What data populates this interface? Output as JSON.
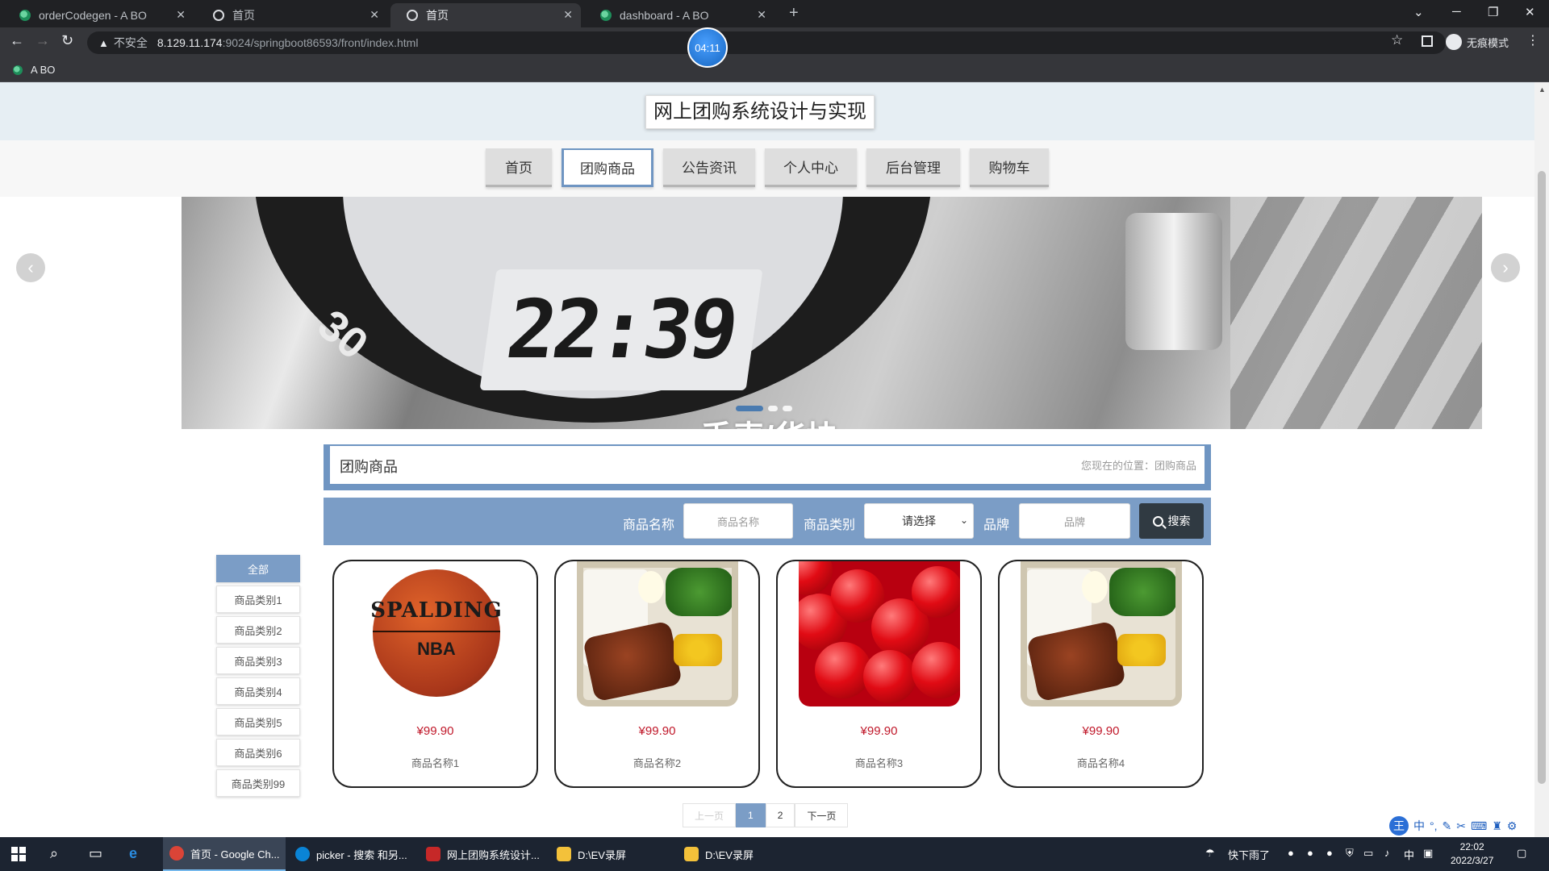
{
  "browser": {
    "tabs": [
      {
        "title": "orderCodegen - A BO",
        "active": false
      },
      {
        "title": "首页",
        "active": false
      },
      {
        "title": "首页",
        "active": true
      },
      {
        "title": "dashboard - A BO",
        "active": false
      }
    ],
    "security_label": "不安全",
    "url_host": "8.129.11.174",
    "url_path": ":9024/springboot86593/front/index.html",
    "profile_label": "无痕模式",
    "bookmark": "A BO",
    "timer": "04:11"
  },
  "site": {
    "title": "网上团购系统设计与实现",
    "nav": [
      {
        "label": "首页",
        "active": false
      },
      {
        "label": "团购商品",
        "active": true
      },
      {
        "label": "公告资讯",
        "active": false
      },
      {
        "label": "个人中心",
        "active": false
      },
      {
        "label": "后台管理",
        "active": false
      },
      {
        "label": "购物车",
        "active": false
      }
    ],
    "banner": {
      "lcd_text": "22:39",
      "bezel_number": "30",
      "caption": "手表/华块"
    }
  },
  "section": {
    "title": "团购商品",
    "breadcrumb": "您现在的位置：团购商品"
  },
  "search": {
    "name_label": "商品名称",
    "name_placeholder": "商品名称",
    "category_label": "商品类别",
    "category_selected": "请选择",
    "brand_label": "品牌",
    "brand_placeholder": "品牌",
    "button_label": "搜索"
  },
  "categories": [
    "全部",
    "商品类别1",
    "商品类别2",
    "商品类别3",
    "商品类别4",
    "商品类别5",
    "商品类别6",
    "商品类别99"
  ],
  "products": [
    {
      "price": "¥99.90",
      "name": "商品名称1",
      "image": "basketball"
    },
    {
      "price": "¥99.90",
      "name": "商品名称2",
      "image": "bento"
    },
    {
      "price": "¥99.90",
      "name": "商品名称3",
      "image": "cherries"
    },
    {
      "price": "¥99.90",
      "name": "商品名称4",
      "image": "bento"
    }
  ],
  "pagination": {
    "prev": "上一页",
    "pages": [
      "1",
      "2"
    ],
    "current": "1",
    "next": "下一页"
  },
  "ime": {
    "badge": "王",
    "mode": "中"
  },
  "taskbar": {
    "apps": [
      {
        "label": "首页 - Google Ch...",
        "color": "#db4437"
      },
      {
        "label": "picker - 搜索 和另...",
        "color": "#0a84d6"
      },
      {
        "label": "网上团购系统设计...",
        "color": "#c62828"
      },
      {
        "label": "D:\\EV录屏",
        "color": "#f3c13a"
      },
      {
        "label": "D:\\EV录屏",
        "color": "#f3c13a"
      }
    ],
    "weather": "快下雨了",
    "lang": "中",
    "time": "22:02",
    "date": "2022/3/27"
  }
}
